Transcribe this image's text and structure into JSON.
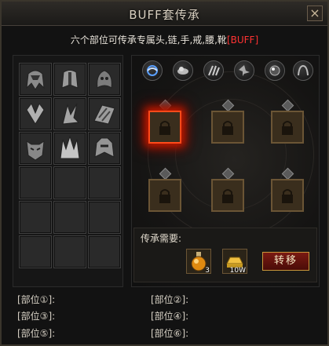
{
  "window": {
    "title": "BUFF套传承",
    "close_glyph": "×"
  },
  "subtitle": {
    "text": "六个部位可传承专属头,链,手,戒,腰,靴",
    "tag": "[BUFF]"
  },
  "left_slots": [
    {
      "icon": "helmet-dragon-icon",
      "filled": true
    },
    {
      "icon": "helmet-warrior-icon",
      "filled": true
    },
    {
      "icon": "helmet-hood-icon",
      "filled": true
    },
    {
      "icon": "necklace-wing-icon",
      "filled": true
    },
    {
      "icon": "necklace-claw-icon",
      "filled": true
    },
    {
      "icon": "bracer-feather-icon",
      "filled": true
    },
    {
      "icon": "mask-demon-icon",
      "filled": true
    },
    {
      "icon": "crown-spike-icon",
      "filled": true
    },
    {
      "icon": "helmet-beast-icon",
      "filled": true
    },
    {
      "filled": false
    },
    {
      "filled": false
    },
    {
      "filled": false
    },
    {
      "filled": false
    },
    {
      "filled": false
    },
    {
      "filled": false
    },
    {
      "filled": false
    },
    {
      "filled": false
    },
    {
      "filled": false
    }
  ],
  "buff_icons": [
    "swirl-buff-icon",
    "cloud-buff-icon",
    "claw-buff-icon",
    "spike-buff-icon",
    "orb-buff-icon",
    "horn-buff-icon"
  ],
  "transfer_slots": [
    {
      "locked": true,
      "active": true
    },
    {
      "locked": true,
      "active": false
    },
    {
      "locked": true,
      "active": false
    },
    {
      "locked": true,
      "active": false
    },
    {
      "locked": true,
      "active": false
    },
    {
      "locked": true,
      "active": false
    }
  ],
  "requirement": {
    "label": "传承需要:",
    "potion_count": "3",
    "gold_amount": "10W"
  },
  "transfer_button": {
    "label": "转移"
  },
  "positions": {
    "p1": "[部位①]:",
    "p2": "[部位②]:",
    "p3": "[部位③]:",
    "p4": "[部位④]:",
    "p5": "[部位⑤]:",
    "p6": "[部位⑥]:"
  },
  "colors": {
    "accent_red": "#ff3333",
    "active_glow": "#ff4a1a",
    "gold_border": "#c8963a"
  }
}
